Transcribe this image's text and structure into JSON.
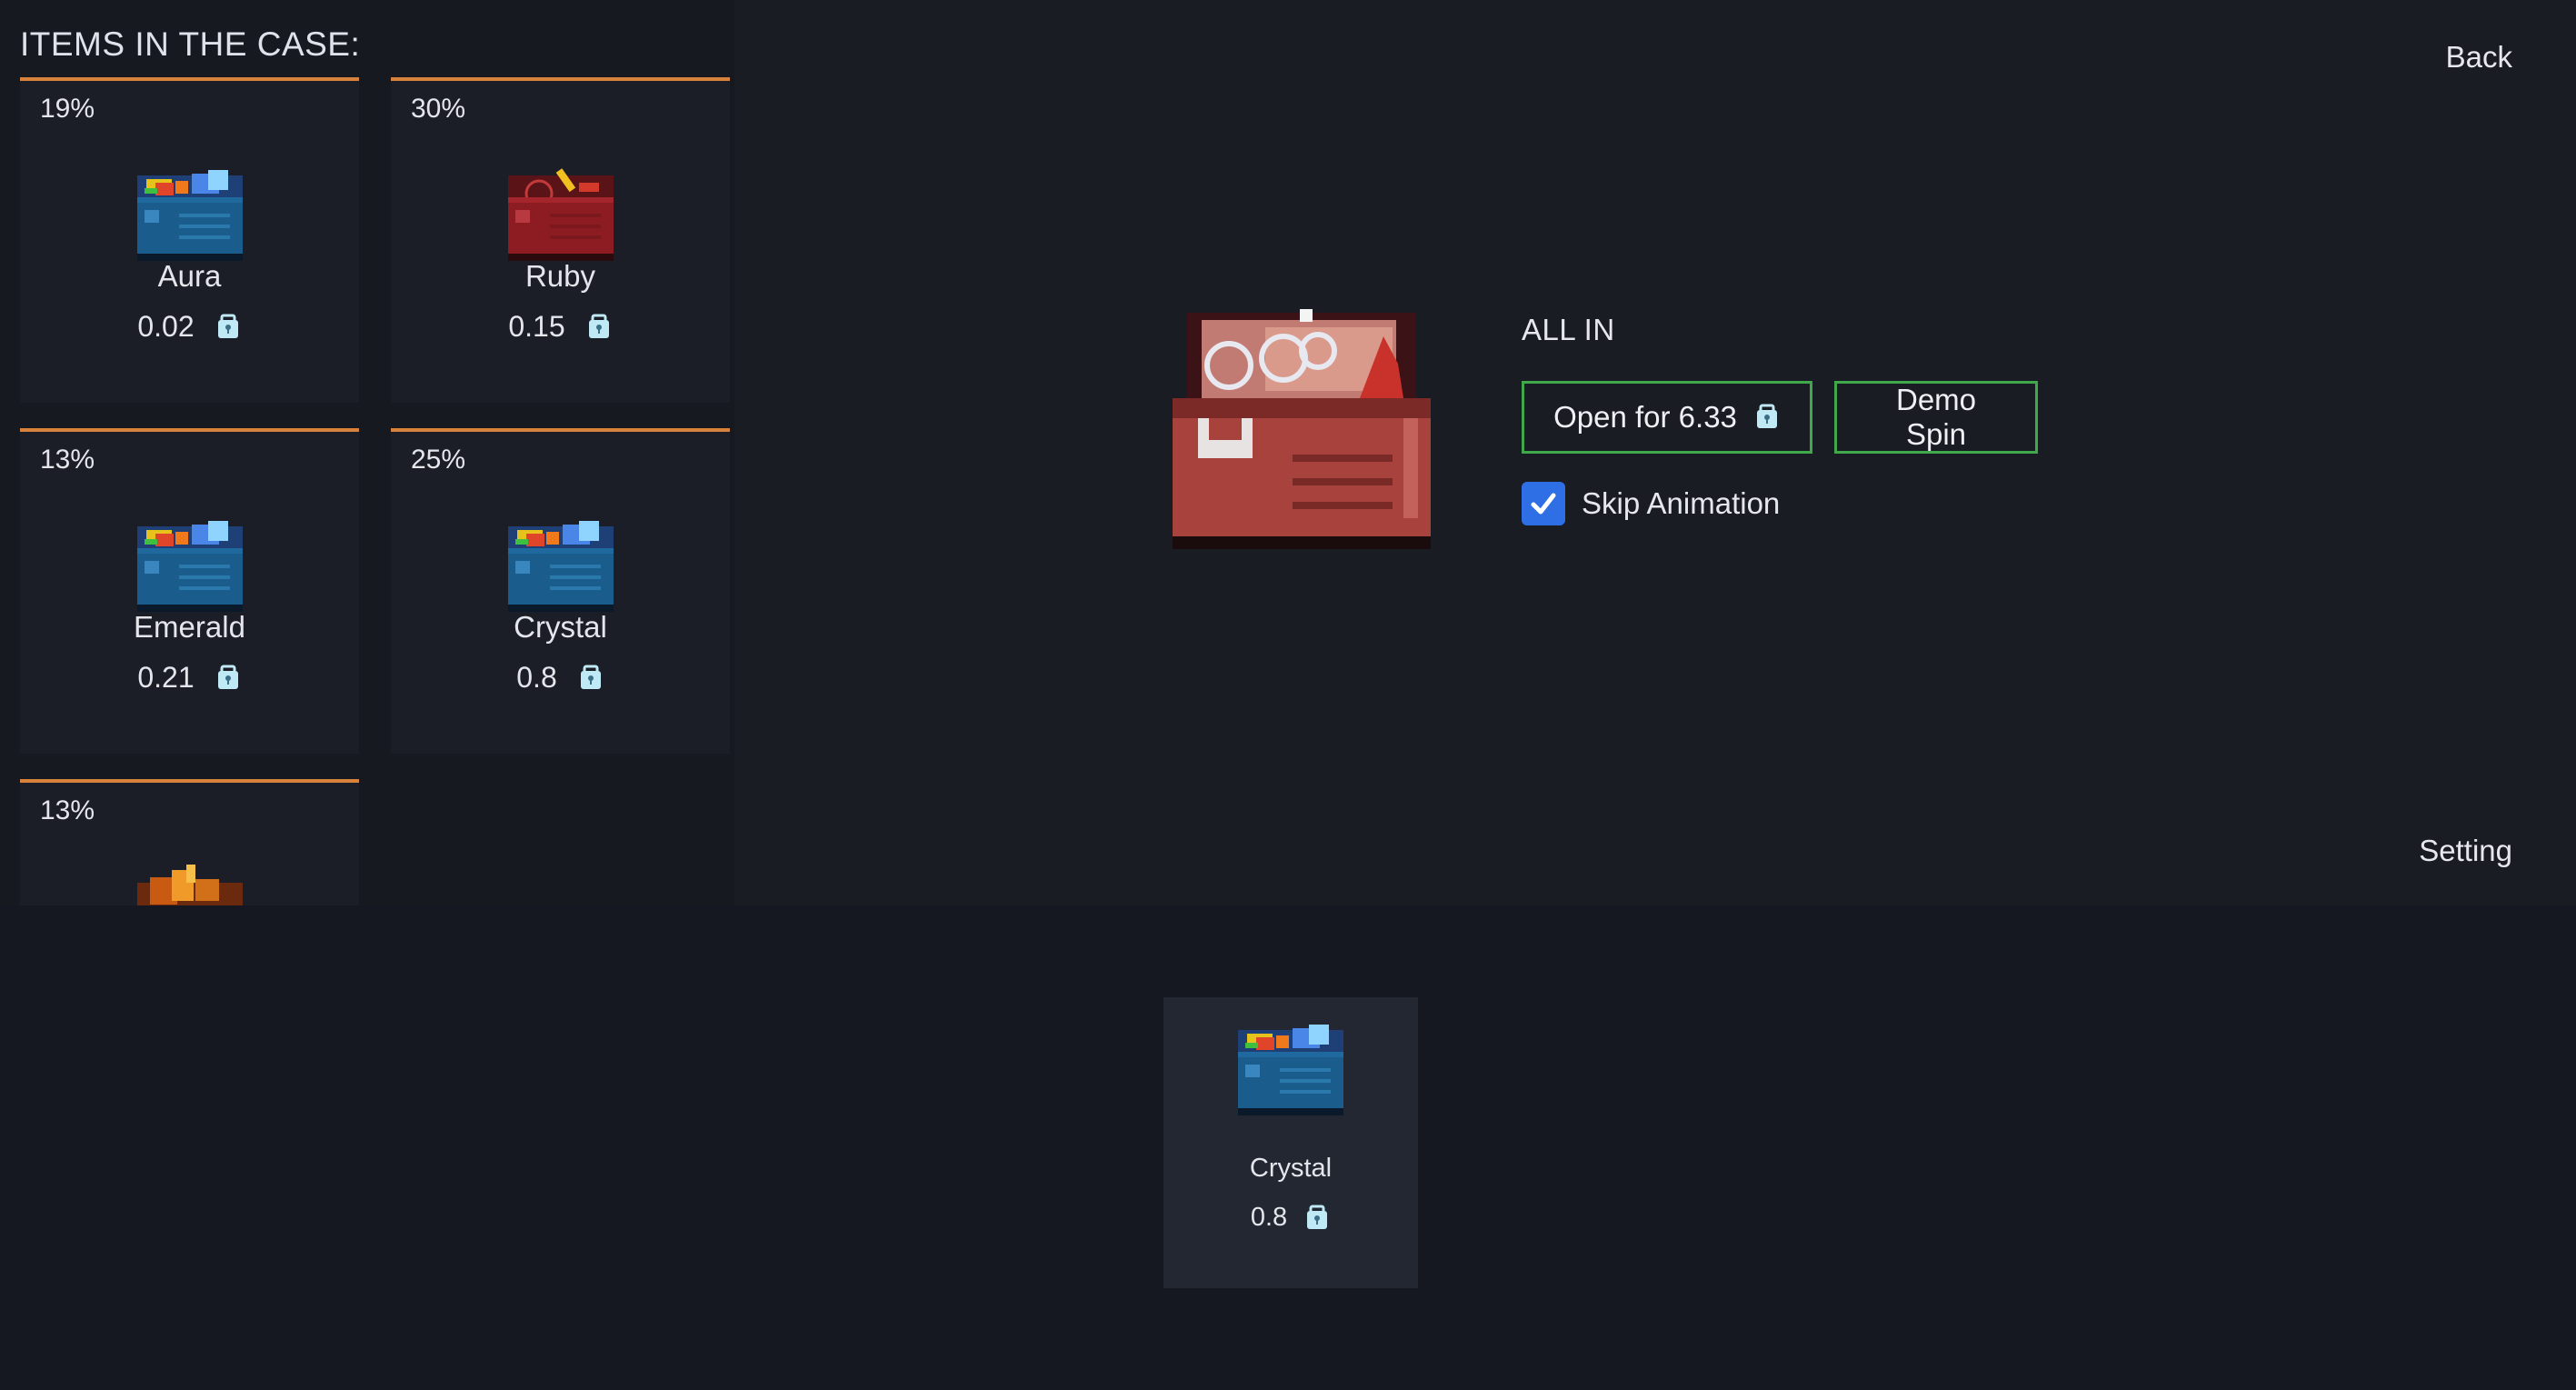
{
  "left_panel": {
    "title": "ITEMS IN THE CASE:",
    "items": [
      {
        "chance": "19%",
        "name": "Aura",
        "price": "0.02",
        "icon": "blue-treasure-chest-icon"
      },
      {
        "chance": "30%",
        "name": "Ruby",
        "price": "0.15",
        "icon": "red-treasure-chest-icon"
      },
      {
        "chance": "13%",
        "name": "Emerald",
        "price": "0.21",
        "icon": "blue-treasure-chest-icon"
      },
      {
        "chance": "25%",
        "name": "Crystal",
        "price": "0.8",
        "icon": "blue-treasure-chest-icon"
      },
      {
        "chance": "13%",
        "name": "",
        "price": "",
        "icon": "orange-treasure-chest-icon"
      }
    ]
  },
  "header": {
    "back_label": "Back",
    "setting_label": "Setting"
  },
  "case": {
    "name": "ALL IN",
    "open_label": "Open for 6.33",
    "demo_label": "Demo Spin",
    "skip_animation_label": "Skip Animation",
    "skip_animation_checked": true,
    "icon": "large-red-treasure-chest-icon"
  },
  "result": {
    "name": "Crystal",
    "price": "0.8",
    "icon": "blue-treasure-chest-icon"
  },
  "colors": {
    "card_border": "#d9823b",
    "button_border": "#3fa84a",
    "checkbox": "#2f6fe6",
    "currency_icon": "#bfe9f5"
  }
}
